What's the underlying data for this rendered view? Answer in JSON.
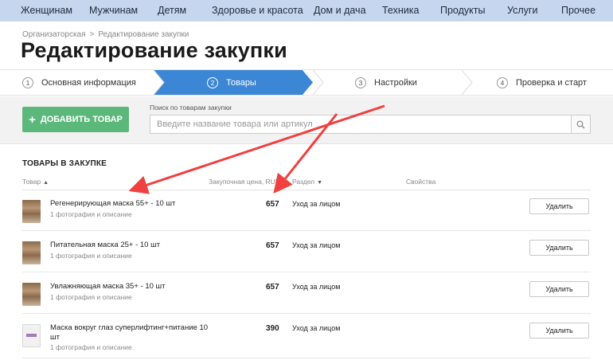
{
  "topnav": [
    "Женщинам",
    "Мужчинам",
    "Детям",
    "Здоровье и красота",
    "Дом и дача",
    "Техника",
    "Продукты",
    "Услуги",
    "Прочее"
  ],
  "breadcrumb": {
    "parent": "Организаторская",
    "separator": ">",
    "current": "Редактирование закупки"
  },
  "page_title": "Редактирование закупки",
  "steps": [
    {
      "num": "1",
      "label": "Основная информация",
      "active": false
    },
    {
      "num": "2",
      "label": "Товары",
      "active": true
    },
    {
      "num": "3",
      "label": "Настройки",
      "active": false
    },
    {
      "num": "4",
      "label": "Проверка и старт",
      "active": false
    }
  ],
  "toolbar": {
    "add_button": "ДОБАВИТЬ ТОВАР",
    "add_icon": "+",
    "search_label": "Поиск по товарам закупки",
    "search_placeholder": "Введите название товара или артикул",
    "search_icon": "search-icon"
  },
  "products": {
    "title": "ТОВАРЫ В ЗАКУПКЕ",
    "columns": {
      "product": "Товар",
      "price": "Закупочная цена, RUB",
      "section": "Раздел",
      "properties": "Свойства"
    },
    "rows": [
      {
        "name": "Регенерирующая маска 55+ - 10 шт",
        "sub": "1 фотография и описание",
        "price": "657",
        "section": "Уход за лицом",
        "action": "Удалить",
        "thumb": "brown"
      },
      {
        "name": "Питательная маска 25+ - 10 шт",
        "sub": "1 фотография и описание",
        "price": "657",
        "section": "Уход за лицом",
        "action": "Удалить",
        "thumb": "brown"
      },
      {
        "name": "Увлажняющая маска 35+ - 10 шт",
        "sub": "1 фотография и описание",
        "price": "657",
        "section": "Уход за лицом",
        "action": "Удалить",
        "thumb": "brown"
      },
      {
        "name": "Маска вокруг глаз суперлифтинг+питание 10 шт",
        "sub": "1 фотография и описание",
        "price": "390",
        "section": "Уход за лицом",
        "action": "Удалить",
        "thumb": "white"
      }
    ]
  },
  "colors": {
    "nav_bg": "#c7d6ef",
    "step_active": "#3b87d6",
    "add_button": "#5cb87a",
    "annotation_arrow": "#f04040"
  }
}
